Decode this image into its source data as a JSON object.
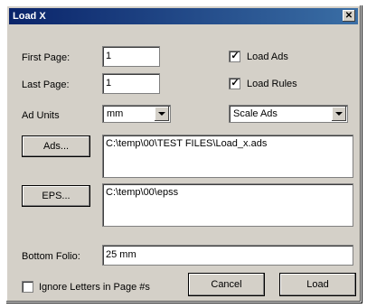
{
  "window": {
    "title": "Load X",
    "close_glyph": "✕"
  },
  "form": {
    "first_page_label": "First Page:",
    "first_page_value": "1",
    "last_page_label": "Last Page:",
    "last_page_value": "1",
    "ad_units_label": "Ad Units",
    "ad_units_value": "mm",
    "scale_value": "Scale Ads",
    "load_ads_label": "Load Ads",
    "load_ads_checked": true,
    "load_rules_label": "Load Rules",
    "load_rules_checked": true,
    "ads_button": "Ads...",
    "ads_path": "C:\\temp\\00\\TEST FILES\\Load_x.ads",
    "eps_button": "EPS...",
    "eps_path": "C:\\temp\\00\\epss",
    "bottom_folio_label": "Bottom Folio:",
    "bottom_folio_value": "25 mm",
    "ignore_letters_label": "Ignore Letters in Page #s",
    "ignore_letters_checked": false
  },
  "buttons": {
    "cancel": "Cancel",
    "load": "Load"
  },
  "icons": {
    "check": "check-icon",
    "dropdown": "chevron-down-icon",
    "close": "close-icon"
  }
}
